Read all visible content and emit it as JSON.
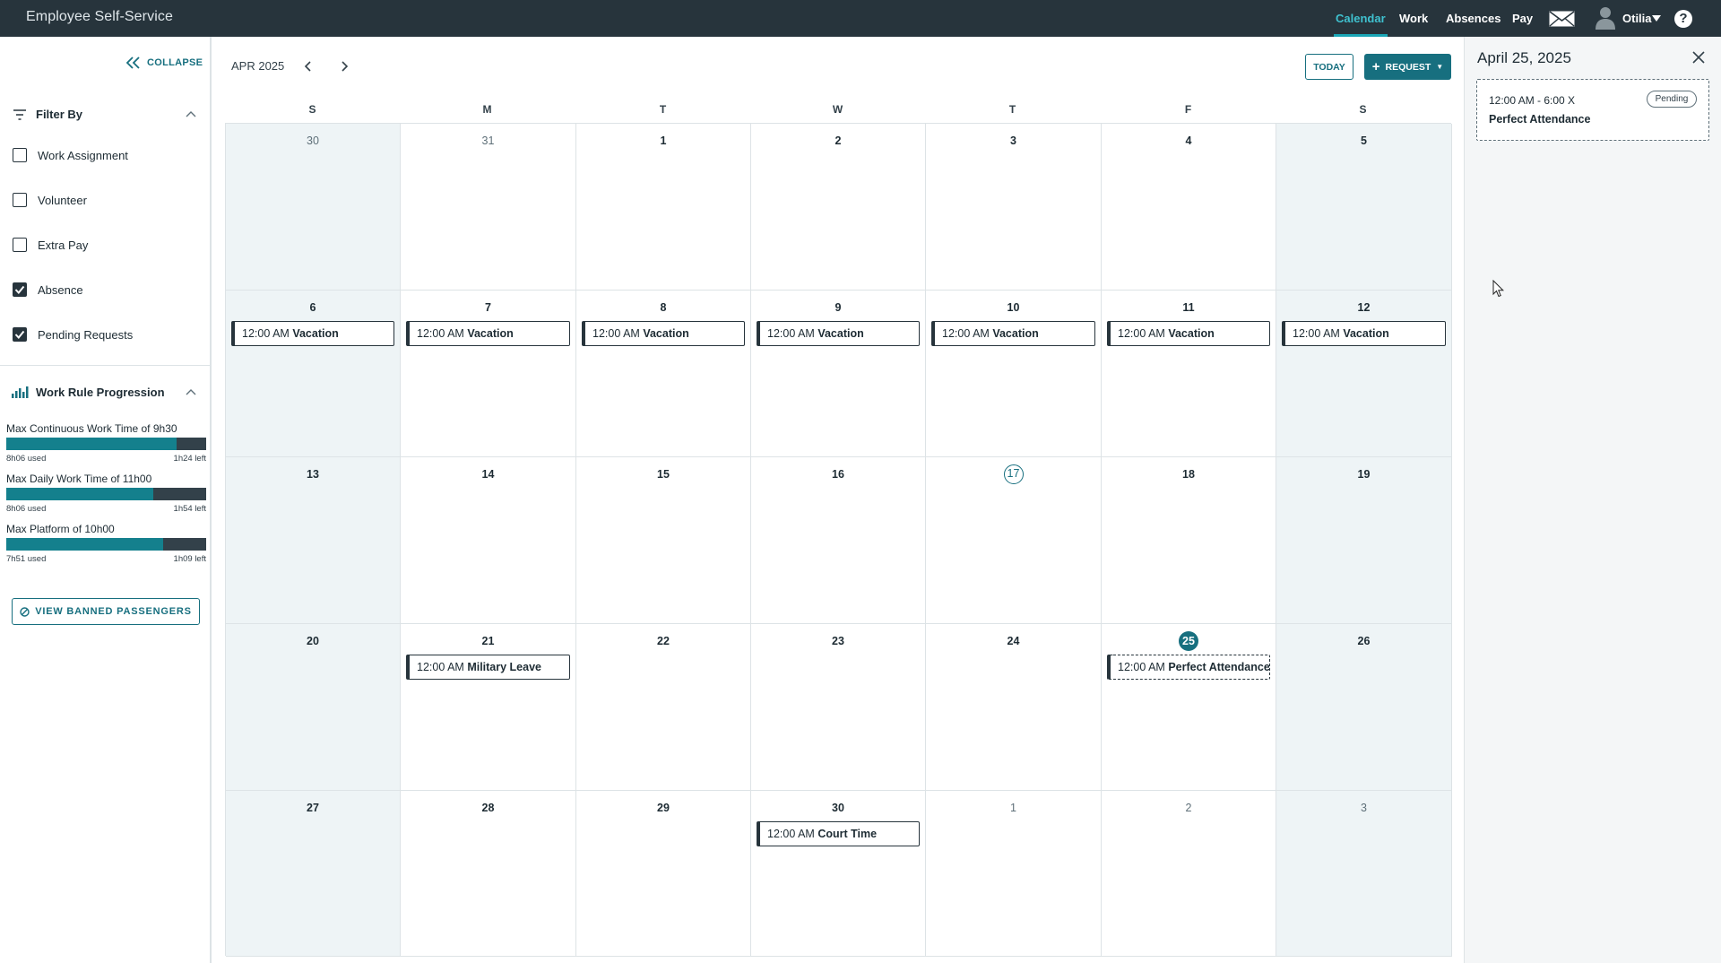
{
  "app": {
    "title": "Employee Self-Service"
  },
  "nav": {
    "calendar": "Calendar",
    "work": "Work",
    "absences": "Absences",
    "pay": "Pay",
    "user": "Otilia",
    "help": "?"
  },
  "colors": {
    "topbar": "#27343c",
    "accent": "#176f7f",
    "nav_active": "#3fc1cf",
    "progress_fill": "#14808d",
    "weekend": "#eef4f6"
  },
  "sidebar": {
    "collapse": "COLLAPSE",
    "filter_title": "Filter By",
    "filters": [
      {
        "label": "Work Assignment",
        "checked": false
      },
      {
        "label": "Volunteer",
        "checked": false
      },
      {
        "label": "Extra Pay",
        "checked": false
      },
      {
        "label": "Absence",
        "checked": true
      },
      {
        "label": "Pending Requests",
        "checked": true
      }
    ],
    "wrp_title": "Work Rule Progression",
    "rules": [
      {
        "title": "Max Continuous Work Time of 9h30",
        "used": "8h06 used",
        "left": "1h24 left",
        "percent": 85.3
      },
      {
        "title": "Max Daily Work Time of 11h00",
        "used": "8h06 used",
        "left": "1h54 left",
        "percent": 73.6
      },
      {
        "title": "Max Platform of 10h00",
        "used": "7h51 used",
        "left": "1h09 left",
        "percent": 78.5
      }
    ],
    "banned_button": "VIEW BANNED PASSENGERS"
  },
  "calendar": {
    "month": "APR 2025",
    "today_button": "TODAY",
    "request_button": "REQUEST",
    "weekdays": [
      "S",
      "M",
      "T",
      "W",
      "T",
      "F",
      "S"
    ],
    "weeks": [
      [
        {
          "d": "30",
          "other": true
        },
        {
          "d": "31",
          "other": true
        },
        {
          "d": "1"
        },
        {
          "d": "2"
        },
        {
          "d": "3"
        },
        {
          "d": "4"
        },
        {
          "d": "5"
        }
      ],
      [
        {
          "d": "6",
          "event": {
            "time": "12:00 AM",
            "name": "Vacation"
          }
        },
        {
          "d": "7",
          "event": {
            "time": "12:00 AM",
            "name": "Vacation"
          }
        },
        {
          "d": "8",
          "event": {
            "time": "12:00 AM",
            "name": "Vacation"
          }
        },
        {
          "d": "9",
          "event": {
            "time": "12:00 AM",
            "name": "Vacation"
          }
        },
        {
          "d": "10",
          "event": {
            "time": "12:00 AM",
            "name": "Vacation"
          }
        },
        {
          "d": "11",
          "event": {
            "time": "12:00 AM",
            "name": "Vacation"
          }
        },
        {
          "d": "12",
          "event": {
            "time": "12:00 AM",
            "name": "Vacation"
          }
        }
      ],
      [
        {
          "d": "13"
        },
        {
          "d": "14"
        },
        {
          "d": "15"
        },
        {
          "d": "16"
        },
        {
          "d": "17",
          "today": true
        },
        {
          "d": "18"
        },
        {
          "d": "19"
        }
      ],
      [
        {
          "d": "20"
        },
        {
          "d": "21",
          "event": {
            "time": "12:00 AM",
            "name": "Military Leave"
          }
        },
        {
          "d": "22"
        },
        {
          "d": "23"
        },
        {
          "d": "24"
        },
        {
          "d": "25",
          "selected": true,
          "event": {
            "time": "12:00 AM",
            "name": "Perfect Attendance",
            "pending": true
          }
        },
        {
          "d": "26"
        }
      ],
      [
        {
          "d": "27"
        },
        {
          "d": "28"
        },
        {
          "d": "29"
        },
        {
          "d": "30",
          "event": {
            "time": "12:00 AM",
            "name": "Court Time"
          }
        },
        {
          "d": "1",
          "other": true
        },
        {
          "d": "2",
          "other": true
        },
        {
          "d": "3",
          "other": true
        }
      ]
    ]
  },
  "detail": {
    "date": "April 25, 2025",
    "time": "12:00 AM - 6:00 X",
    "status": "Pending",
    "name": "Perfect Attendance"
  }
}
